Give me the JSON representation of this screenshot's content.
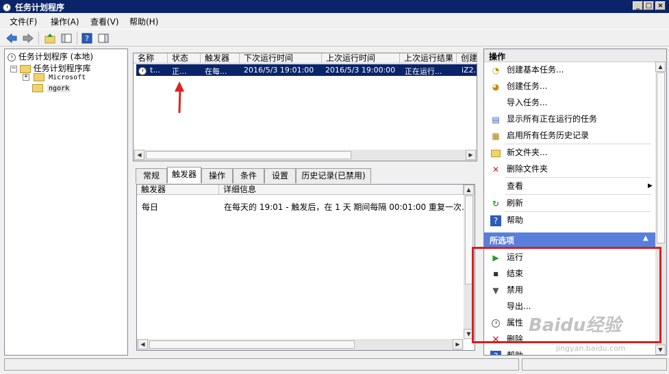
{
  "window": {
    "title": "任务计划程序"
  },
  "menubar": [
    {
      "label": "文件(F)"
    },
    {
      "label": "操作(A)"
    },
    {
      "label": "查看(V)"
    },
    {
      "label": "帮助(H)"
    }
  ],
  "tree": {
    "root": "任务计划程序 (本地)",
    "library": "任务计划程序库",
    "children": [
      "Microsoft",
      "ngork"
    ]
  },
  "task_table": {
    "columns": [
      "名称",
      "状态",
      "触发器",
      "下次运行时间",
      "上次运行时间",
      "上次运行结果",
      "创建"
    ],
    "row": {
      "name": "t...",
      "status": "正...",
      "trigger": "在每...",
      "next_run": "2016/5/3 19:01:00",
      "last_run": "2016/5/3 19:00:00",
      "last_result": "正在运行...",
      "author": "iZ2..."
    }
  },
  "tabs": [
    "常规",
    "触发器",
    "操作",
    "条件",
    "设置",
    "历史记录(已禁用)"
  ],
  "active_tab": "触发器",
  "trigger_table": {
    "columns": [
      "触发器",
      "详细信息"
    ],
    "rows": [
      {
        "trigger": "每日",
        "detail": "在每天的 19:01 - 触发后，在 1 天 期间每隔 00:01:00 重复一次..."
      }
    ]
  },
  "actions_panel": {
    "header": "操作",
    "items": [
      {
        "label": "创建基本任务...",
        "icon": "create-basic-task-icon"
      },
      {
        "label": "创建任务...",
        "icon": "create-task-icon"
      },
      {
        "label": "导入任务...",
        "icon": ""
      },
      {
        "label": "显示所有正在运行的任务",
        "icon": "running-tasks-icon"
      },
      {
        "label": "启用所有任务历史记录",
        "icon": "history-icon"
      },
      {
        "label": "新文件夹...",
        "icon": "new-folder-icon"
      },
      {
        "label": "删除文件夹",
        "icon": "delete-icon"
      },
      {
        "label": "查看",
        "icon": ""
      },
      {
        "label": "刷新",
        "icon": "refresh-icon"
      },
      {
        "label": "帮助",
        "icon": "help-icon"
      }
    ],
    "selected_header": "所选项",
    "selected_items": [
      {
        "label": "运行",
        "icon": "run-icon"
      },
      {
        "label": "结束",
        "icon": "stop-icon"
      },
      {
        "label": "禁用",
        "icon": "disable-icon"
      },
      {
        "label": "导出...",
        "icon": ""
      },
      {
        "label": "属性",
        "icon": "properties-icon"
      },
      {
        "label": "删除",
        "icon": "delete-icon"
      },
      {
        "label": "帮助",
        "icon": "help-icon"
      }
    ]
  },
  "watermark": {
    "brand": "Baidu经验",
    "url": "jingyan.baidu.com"
  },
  "colors": {
    "titlebar": "#0a246a",
    "selection": "#0a246a",
    "highlight_box": "#d42020",
    "arrow": "#e02020",
    "section_header": "#5a7edc"
  }
}
